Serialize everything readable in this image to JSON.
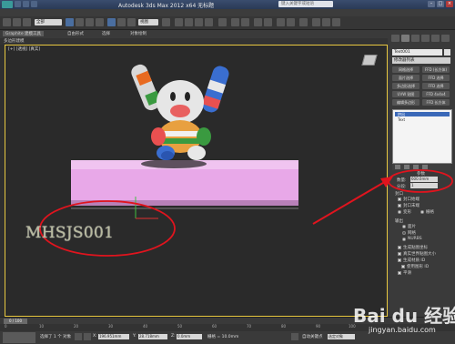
{
  "titlebar": {
    "title": "Autodesk 3ds Max 2012 x64   无标题",
    "search_placeholder": "键入关键字或短语"
  },
  "ribbon": {
    "tabs": [
      "Graphite 建模工具",
      "自由形式",
      "选择",
      "对象绘制"
    ],
    "sub_label": "多边形建模"
  },
  "toolbar": {
    "selection_filter": "全部",
    "view_dropdown": "视图"
  },
  "viewport": {
    "label": "[+] [透视] [真实]",
    "scene_text": "MHSJS001",
    "highlight_color": "#e0141e",
    "box_color": "#e8a8e8"
  },
  "command_panel": {
    "object_name": "Text001",
    "modifier_list": "修改器列表",
    "modifier_buttons": [
      "网格选择",
      "FFD (长方体)",
      "面片选择",
      "FFD 选择",
      "多边形选择",
      "FFD 选择",
      "UVW 贴图",
      "FFD 4x4x4",
      "编辑多边形",
      "FFD 长方体",
      "编辑样条线",
      "FFD 圆柱体"
    ],
    "stack_items": [
      "挤出",
      "Text"
    ],
    "rollout_title": "参数",
    "amount_label": "数量:",
    "amount_value": "600.0mm",
    "segments_label": "分段:",
    "segments_value": "1",
    "capping_title": "封口",
    "cap_start": "封口始端",
    "cap_end": "封口末端",
    "morph": "变形",
    "grid": "栅格",
    "output_title": "输出",
    "output_patch": "面片",
    "output_mesh": "网格",
    "output_nurbs": "NURBS",
    "gen_mapping": "生成贴图坐标",
    "real_world": "真实世界贴图大小",
    "gen_mat_ids": "生成材质 ID",
    "use_shape_ids": "使用图形 ID",
    "smooth": "平滑"
  },
  "timeline": {
    "frame_label": "0 / 100",
    "ticks": [
      "0",
      "10",
      "20",
      "30",
      "40",
      "50",
      "60",
      "70",
      "80",
      "90",
      "100"
    ]
  },
  "status": {
    "selection": "选择了 1 个 对象",
    "x_label": "X:",
    "x_value": "196.951mm",
    "y_label": "Y:",
    "y_value": "28.718mm",
    "z_label": "Z:",
    "z_value": "0.0mm",
    "grid_label": "栅格 = 10.0mm",
    "autokey": "自动关键点",
    "selected": "选定对象"
  },
  "watermark": {
    "brand": "Bai du 经验",
    "url": "jingyan.baidu.com"
  }
}
